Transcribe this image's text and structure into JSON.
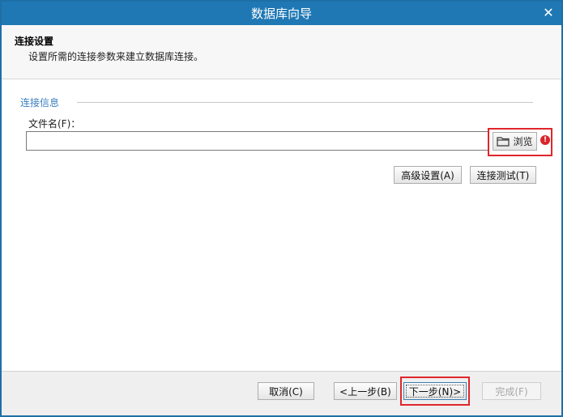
{
  "window": {
    "title": "数据库向导",
    "close_icon": "✕"
  },
  "header": {
    "title": "连接设置",
    "subtitle": "设置所需的连接参数来建立数据库连接。"
  },
  "connection": {
    "group_label": "连接信息",
    "file_label": "文件名(F)：",
    "file_value": "",
    "browse_label": "浏览",
    "warning_glyph": "!",
    "advanced_label": "高级设置(A)",
    "test_label": "连接测试(T)"
  },
  "footer": {
    "cancel_label": "取消(C)",
    "back_label": "<上一步(B)",
    "next_label": "下一步(N)>",
    "finish_label": "完成(F)"
  },
  "colors": {
    "titlebar": "#1f78b4",
    "highlight": "#e0262b",
    "group_label": "#3a7fbf"
  }
}
